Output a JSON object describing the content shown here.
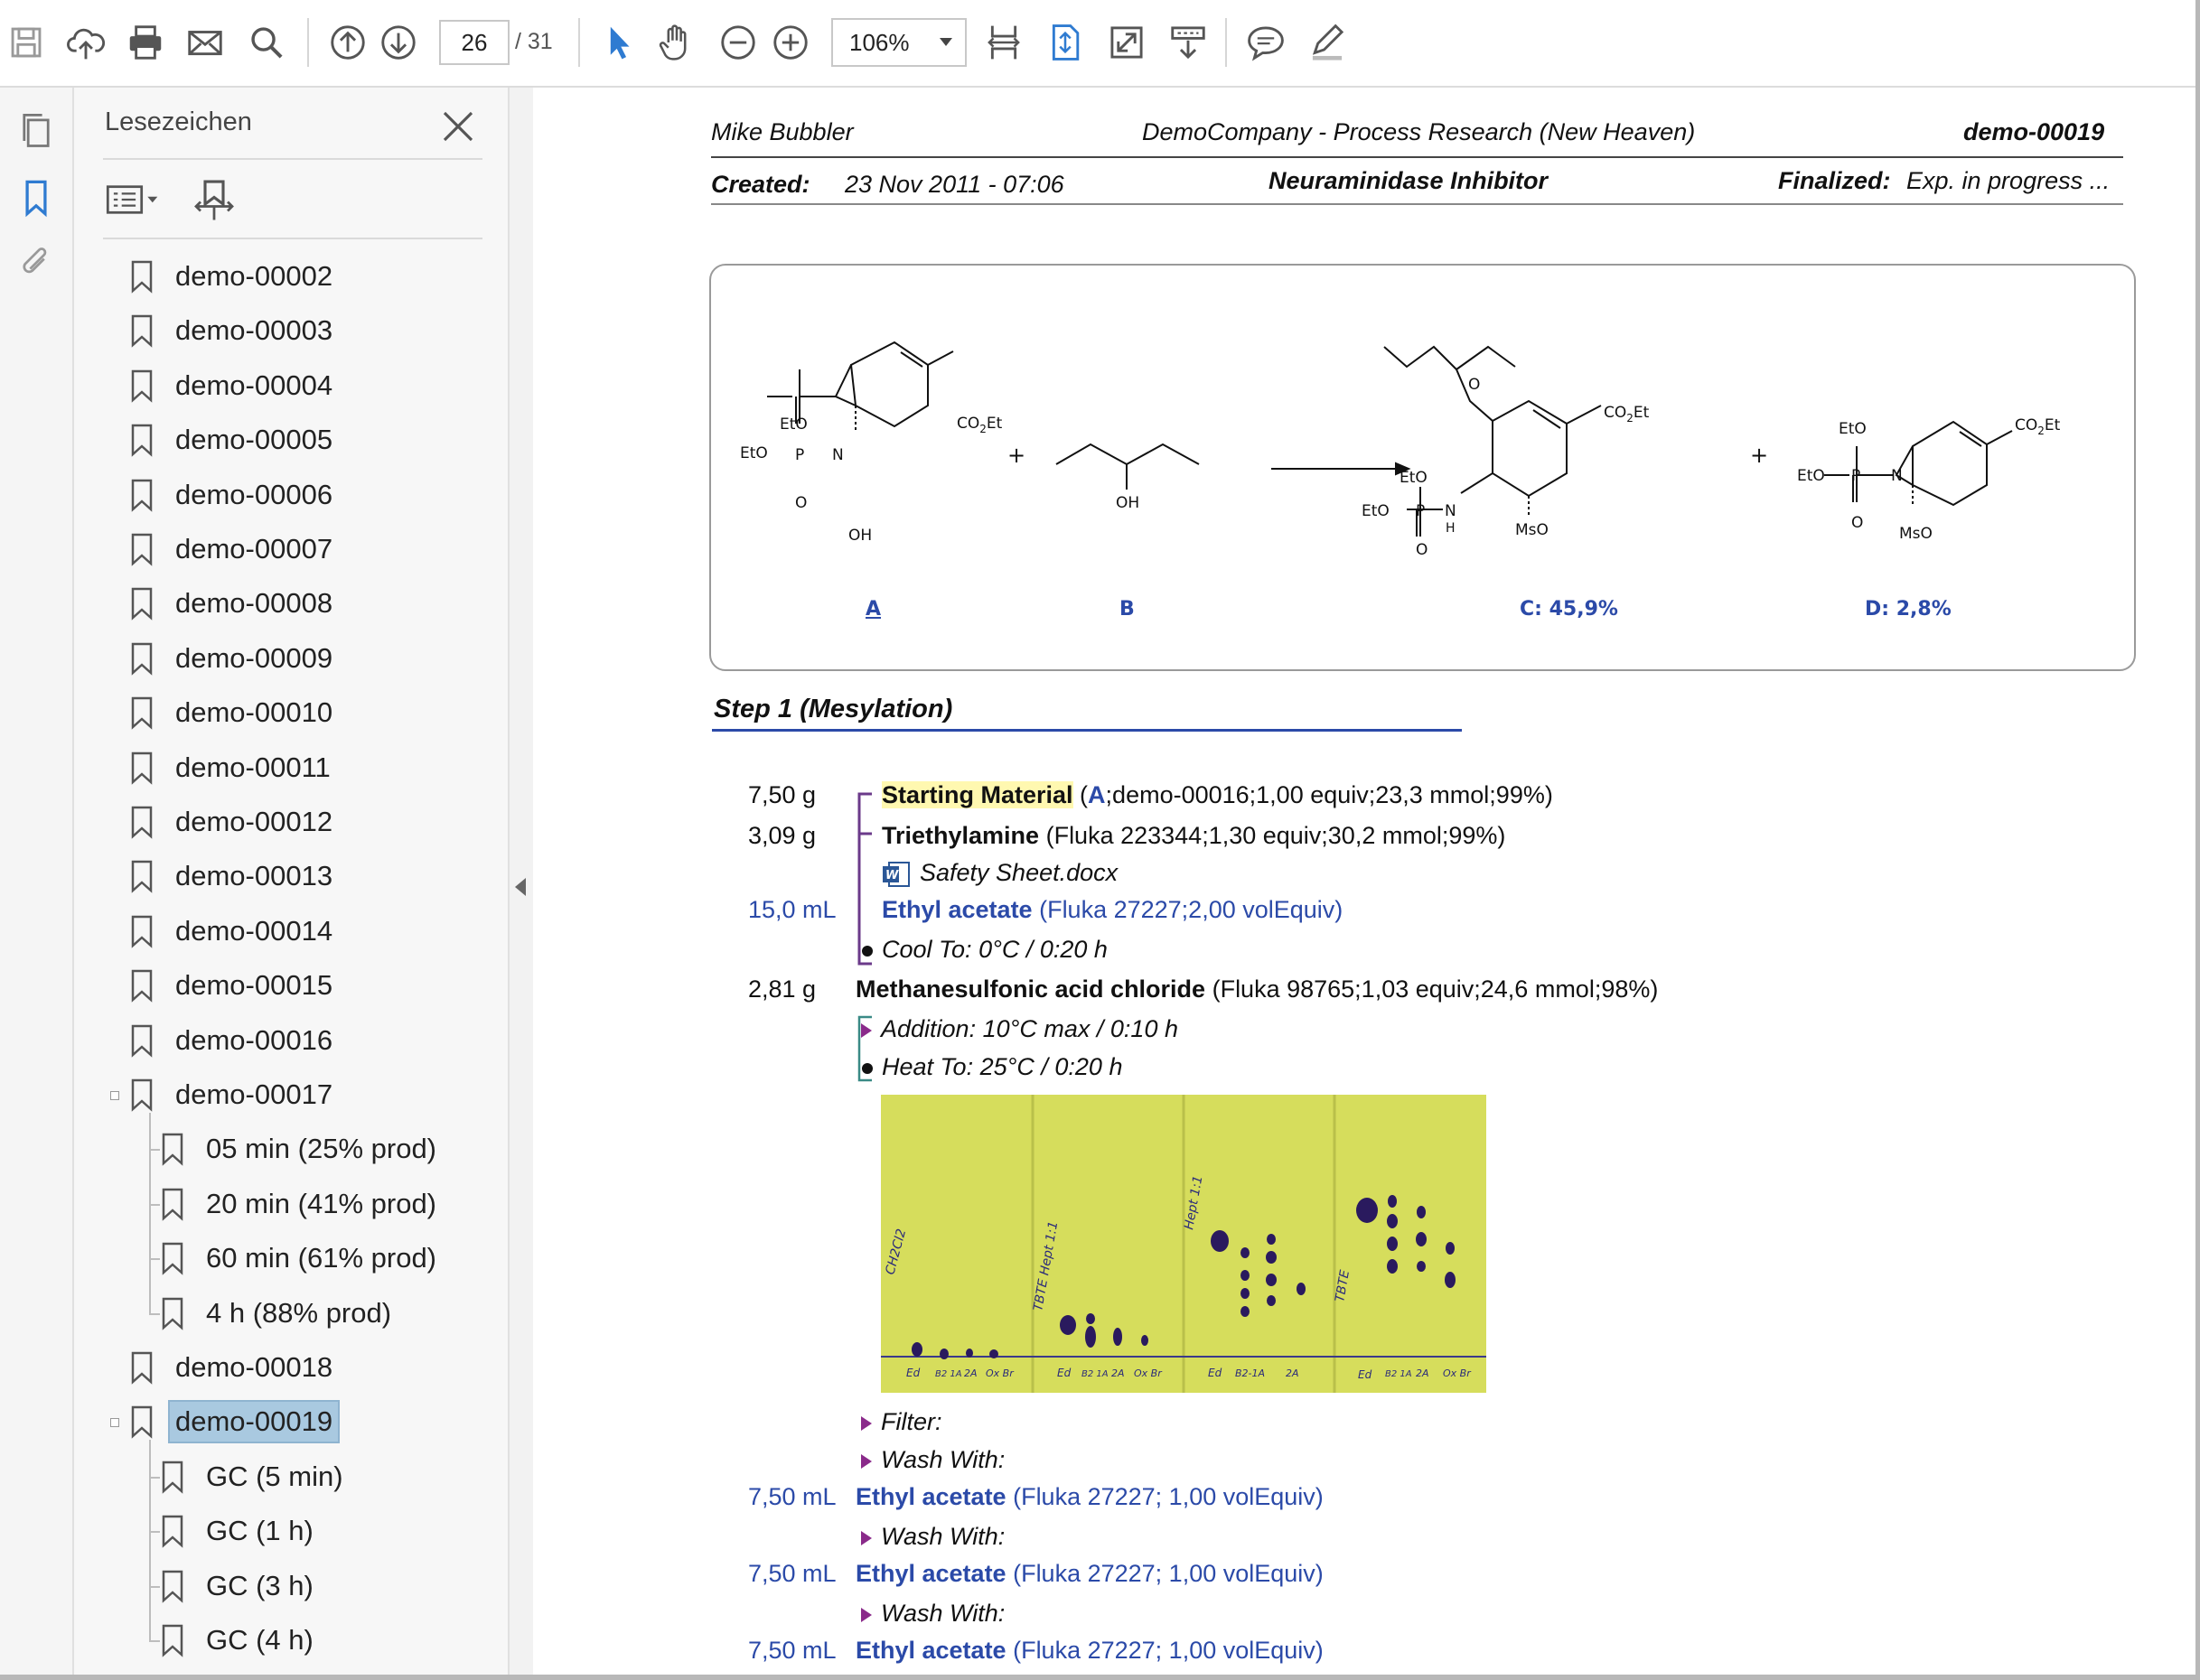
{
  "toolbar": {
    "page_current": "26",
    "page_total": "/ 31",
    "zoom": "106%",
    "icons": [
      "save-icon",
      "cloud-upload-icon",
      "print-icon",
      "mail-icon",
      "search-icon",
      "page-up-icon",
      "page-down-icon",
      "select-cursor-icon",
      "hand-tool-icon",
      "zoom-out-icon",
      "zoom-in-icon",
      "fit-width-icon",
      "fit-page-icon",
      "fullscreen-icon",
      "read-mode-icon",
      "comment-icon",
      "highlight-pen-icon"
    ]
  },
  "panel": {
    "title": "Lesezeichen",
    "bookmarks": [
      {
        "label": "demo-00002",
        "level": 0
      },
      {
        "label": "demo-00003",
        "level": 0
      },
      {
        "label": "demo-00004",
        "level": 0
      },
      {
        "label": "demo-00005",
        "level": 0
      },
      {
        "label": "demo-00006",
        "level": 0
      },
      {
        "label": "demo-00007",
        "level": 0
      },
      {
        "label": "demo-00008",
        "level": 0
      },
      {
        "label": "demo-00009",
        "level": 0
      },
      {
        "label": "demo-00010",
        "level": 0
      },
      {
        "label": "demo-00011",
        "level": 0
      },
      {
        "label": "demo-00012",
        "level": 0
      },
      {
        "label": "demo-00013",
        "level": 0
      },
      {
        "label": "demo-00014",
        "level": 0
      },
      {
        "label": "demo-00015",
        "level": 0
      },
      {
        "label": "demo-00016",
        "level": 0
      },
      {
        "label": "demo-00017",
        "level": 0
      },
      {
        "label": "05 min (25% prod)",
        "level": 1
      },
      {
        "label": "20 min (41% prod)",
        "level": 1
      },
      {
        "label": "60 min (61% prod)",
        "level": 1
      },
      {
        "label": "4 h (88% prod)",
        "level": 1
      },
      {
        "label": "demo-00018",
        "level": 0
      },
      {
        "label": "demo-00019",
        "level": 0,
        "selected": true
      },
      {
        "label": "GC (5 min)",
        "level": 1
      },
      {
        "label": "GC (1 h)",
        "level": 1
      },
      {
        "label": "GC (3 h)",
        "level": 1
      },
      {
        "label": "GC (4 h)",
        "level": 1
      }
    ]
  },
  "doc": {
    "author": "Mike Bubbler",
    "company": "DemoCompany - Process Research (New Heaven)",
    "doc_id": "demo-00019",
    "created_label": "Created:",
    "created_value": "23 Nov 2011 - 07:06",
    "project": "Neuraminidase Inhibitor",
    "finalized_label": "Finalized:",
    "finalized_value": "Exp. in progress ...",
    "scheme": {
      "label_a": "A",
      "label_b": "B",
      "label_c": "C: 45,9%",
      "label_d": "D: 2,8%",
      "atom_labels": {
        "eto": "EtO",
        "p": "P",
        "n": "N",
        "nh": "H",
        "o": "O",
        "oh": "OH",
        "mso": "MsO",
        "co2et": "CO",
        "co2et_sub": "2",
        "co2et_tail": "Et",
        "plus": "+"
      }
    },
    "step_title": "Step 1 (Mesylation)",
    "lines": {
      "sm_amount": "7,50 g",
      "sm_name": "Starting Material",
      "sm_open": " (",
      "sm_ref": "A",
      "sm_rest": ";demo-00016;1,00 equiv;23,3 mmol;99%)",
      "tea_amount": "3,09 g",
      "tea_name": "Triethylamine",
      "tea_rest": " (Fluka 223344;1,30 equiv;30,2 mmol;99%)",
      "safety_sheet": "Safety Sheet.docx",
      "ea1_amount": "15,0 mL",
      "ea1_name": "Ethyl acetate",
      "ea1_rest": " (Fluka 27227;2,00 volEquiv)",
      "cool": "Cool To: 0°C / 0:20 h",
      "msc_amount": "2,81 g",
      "msc_name": "Methanesulfonic acid chloride",
      "msc_rest": " (Fluka 98765;1,03 equiv;24,6 mmol;98%)",
      "addition": "Addition: 10°C max / 0:10 h",
      "heat": "Heat To: 25°C / 0:20 h",
      "filter": "Filter:",
      "wash1": "Wash With:",
      "ea2_amount": "7,50 mL",
      "ea2_name": "Ethyl acetate",
      "ea2_rest": " (Fluka 27227; 1,00 volEquiv)",
      "wash2": "Wash With:",
      "ea3_amount": "7,50 mL",
      "ea3_name": "Ethyl acetate",
      "ea3_rest": " (Fluka 27227; 1,00 volEquiv)",
      "wash3": "Wash With:",
      "ea4_amount": "7,50 mL",
      "ea4_name": "Ethyl acetate",
      "ea4_rest": " (Fluka 27227; 1,00 volEquiv)"
    },
    "tlc_plate": {
      "lane_notes": [
        "CH2Cl2",
        "TBTE Hept 1:1",
        "Hept 1:1",
        "TBTE"
      ],
      "spot_labels": [
        "Ed",
        "B2 1A",
        "2A",
        "Ox Br",
        "Ed",
        "B2 1A",
        "2A",
        "Ox Br",
        "Ed",
        "B2-1A",
        "2A",
        "Ed",
        "B2 1A",
        "2A",
        "Ox Br"
      ],
      "colors": {
        "plate": "#d4dc5a",
        "spot": "#2a1a5e"
      }
    }
  },
  "colors": {
    "accent": "#2b4aa8",
    "highlight": "#fff8b0",
    "selection": "#a9c9e0"
  }
}
